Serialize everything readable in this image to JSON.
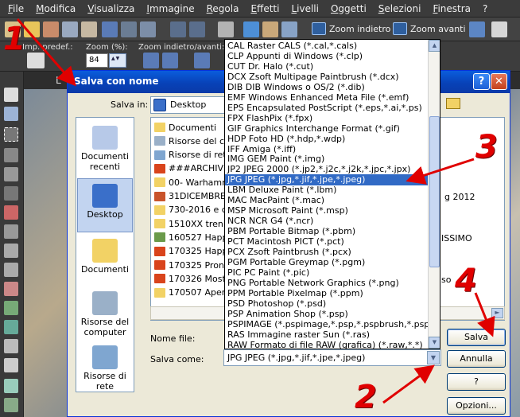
{
  "menu": [
    "File",
    "Modifica",
    "Visualizza",
    "Immagine",
    "Regola",
    "Effetti",
    "Livelli",
    "Oggetti",
    "Selezioni",
    "Finestra",
    "?"
  ],
  "toolbar": {
    "zoom_back": "Zoom indietro",
    "zoom_forward": "Zoom avanti"
  },
  "options": {
    "preset_label": "Imp. predef.:",
    "zoom_label": "Zoom (%):",
    "zoom_value": "84",
    "zoom_nav_label": "Zoom indietro/avanti:"
  },
  "document": {
    "title_fragment": "L"
  },
  "dialog": {
    "title": "Salva con nome",
    "save_in_label": "Salva in:",
    "save_in_value": "Desktop",
    "places": [
      "Documenti recenti",
      "Desktop",
      "Documenti",
      "Risorse del computer",
      "Risorse di rete"
    ],
    "files": [
      "Documenti",
      "Risorse del comp",
      "Risorse di rete",
      "###ARCHIVIO",
      "00- Warhamm",
      "31DICEMBRE 20",
      "730-2016 e codi",
      "1510XX treni e F",
      "160527 Happym",
      "170325 Happym",
      "170325 Pronte",
      "170326 Mostra",
      "170507 Aperisc"
    ],
    "right_fragments": {
      "g2012": "g 2012",
      "issimo": "ISSIMO",
      "so": "so"
    },
    "filename_label": "Nome file:",
    "savetype_label": "Salva come:",
    "savetype_value": "JPG JPEG  (*.jpg,*.jif,*.jpe,*.jpeg)",
    "buttons": {
      "save": "Salva",
      "cancel": "Annulla",
      "help": "?",
      "options": "Opzioni..."
    }
  },
  "dropdown": {
    "items": [
      "CAL Raster CALS (*.cal,*.cals)",
      "CLP Appunti di Windows (*.clp)",
      "CUT Dr. Halo (*.cut)",
      "DCX Zsoft Multipage Paintbrush (*.dcx)",
      "DIB DIB Windows o OS/2 (*.dib)",
      "EMF Windows Enhanced Meta File (*.emf)",
      "EPS Encapsulated PostScript (*.eps,*.ai,*.ps)",
      "FPX FlashPix (*.fpx)",
      "GIF Graphics Interchange Format (*.gif)",
      "HDP Foto HD (*.hdp,*.wdp)",
      "IFF Amiga (*.iff)",
      "IMG GEM Paint (*.img)",
      "JP2 JPEG 2000 (*.jp2,*.j2c,*.j2k,*.jpc,*.jpx)",
      "JPG JPEG  (*.jpg,*.jif,*.jpe,*.jpeg)",
      "LBM Deluxe Paint (*.lbm)",
      "MAC MacPaint (*.mac)",
      "MSP Microsoft Paint (*.msp)",
      "NCR NCR G4 (*.ncr)",
      "PBM Portable Bitmap (*.pbm)",
      "PCT Macintosh PICT (*.pct)",
      "PCX Zsoft Paintbrush (*.pcx)",
      "PGM Portable Greymap (*.pgm)",
      "PIC PC Paint (*.pic)",
      "PNG Portable Network Graphics (*.png)",
      "PPM Portable Pixelmap (*.ppm)",
      "PSD Photoshop (*.psd)",
      "PSP Animation Shop (*.psp)",
      "PSPIMAGE (*.pspimage,*.psp,*.pspbrush,*.pspframe,*",
      "RAS Immagine raster Sun (*.ras)",
      "RAW Formato di file RAW (grafica) (*.raw,*.*)"
    ],
    "selected_index": 13
  },
  "annotations": [
    "1",
    "2",
    "3",
    "4"
  ],
  "colors": {
    "annotation": "#e00000",
    "selection": "#316ac5",
    "xp_title": "#0842b8"
  }
}
